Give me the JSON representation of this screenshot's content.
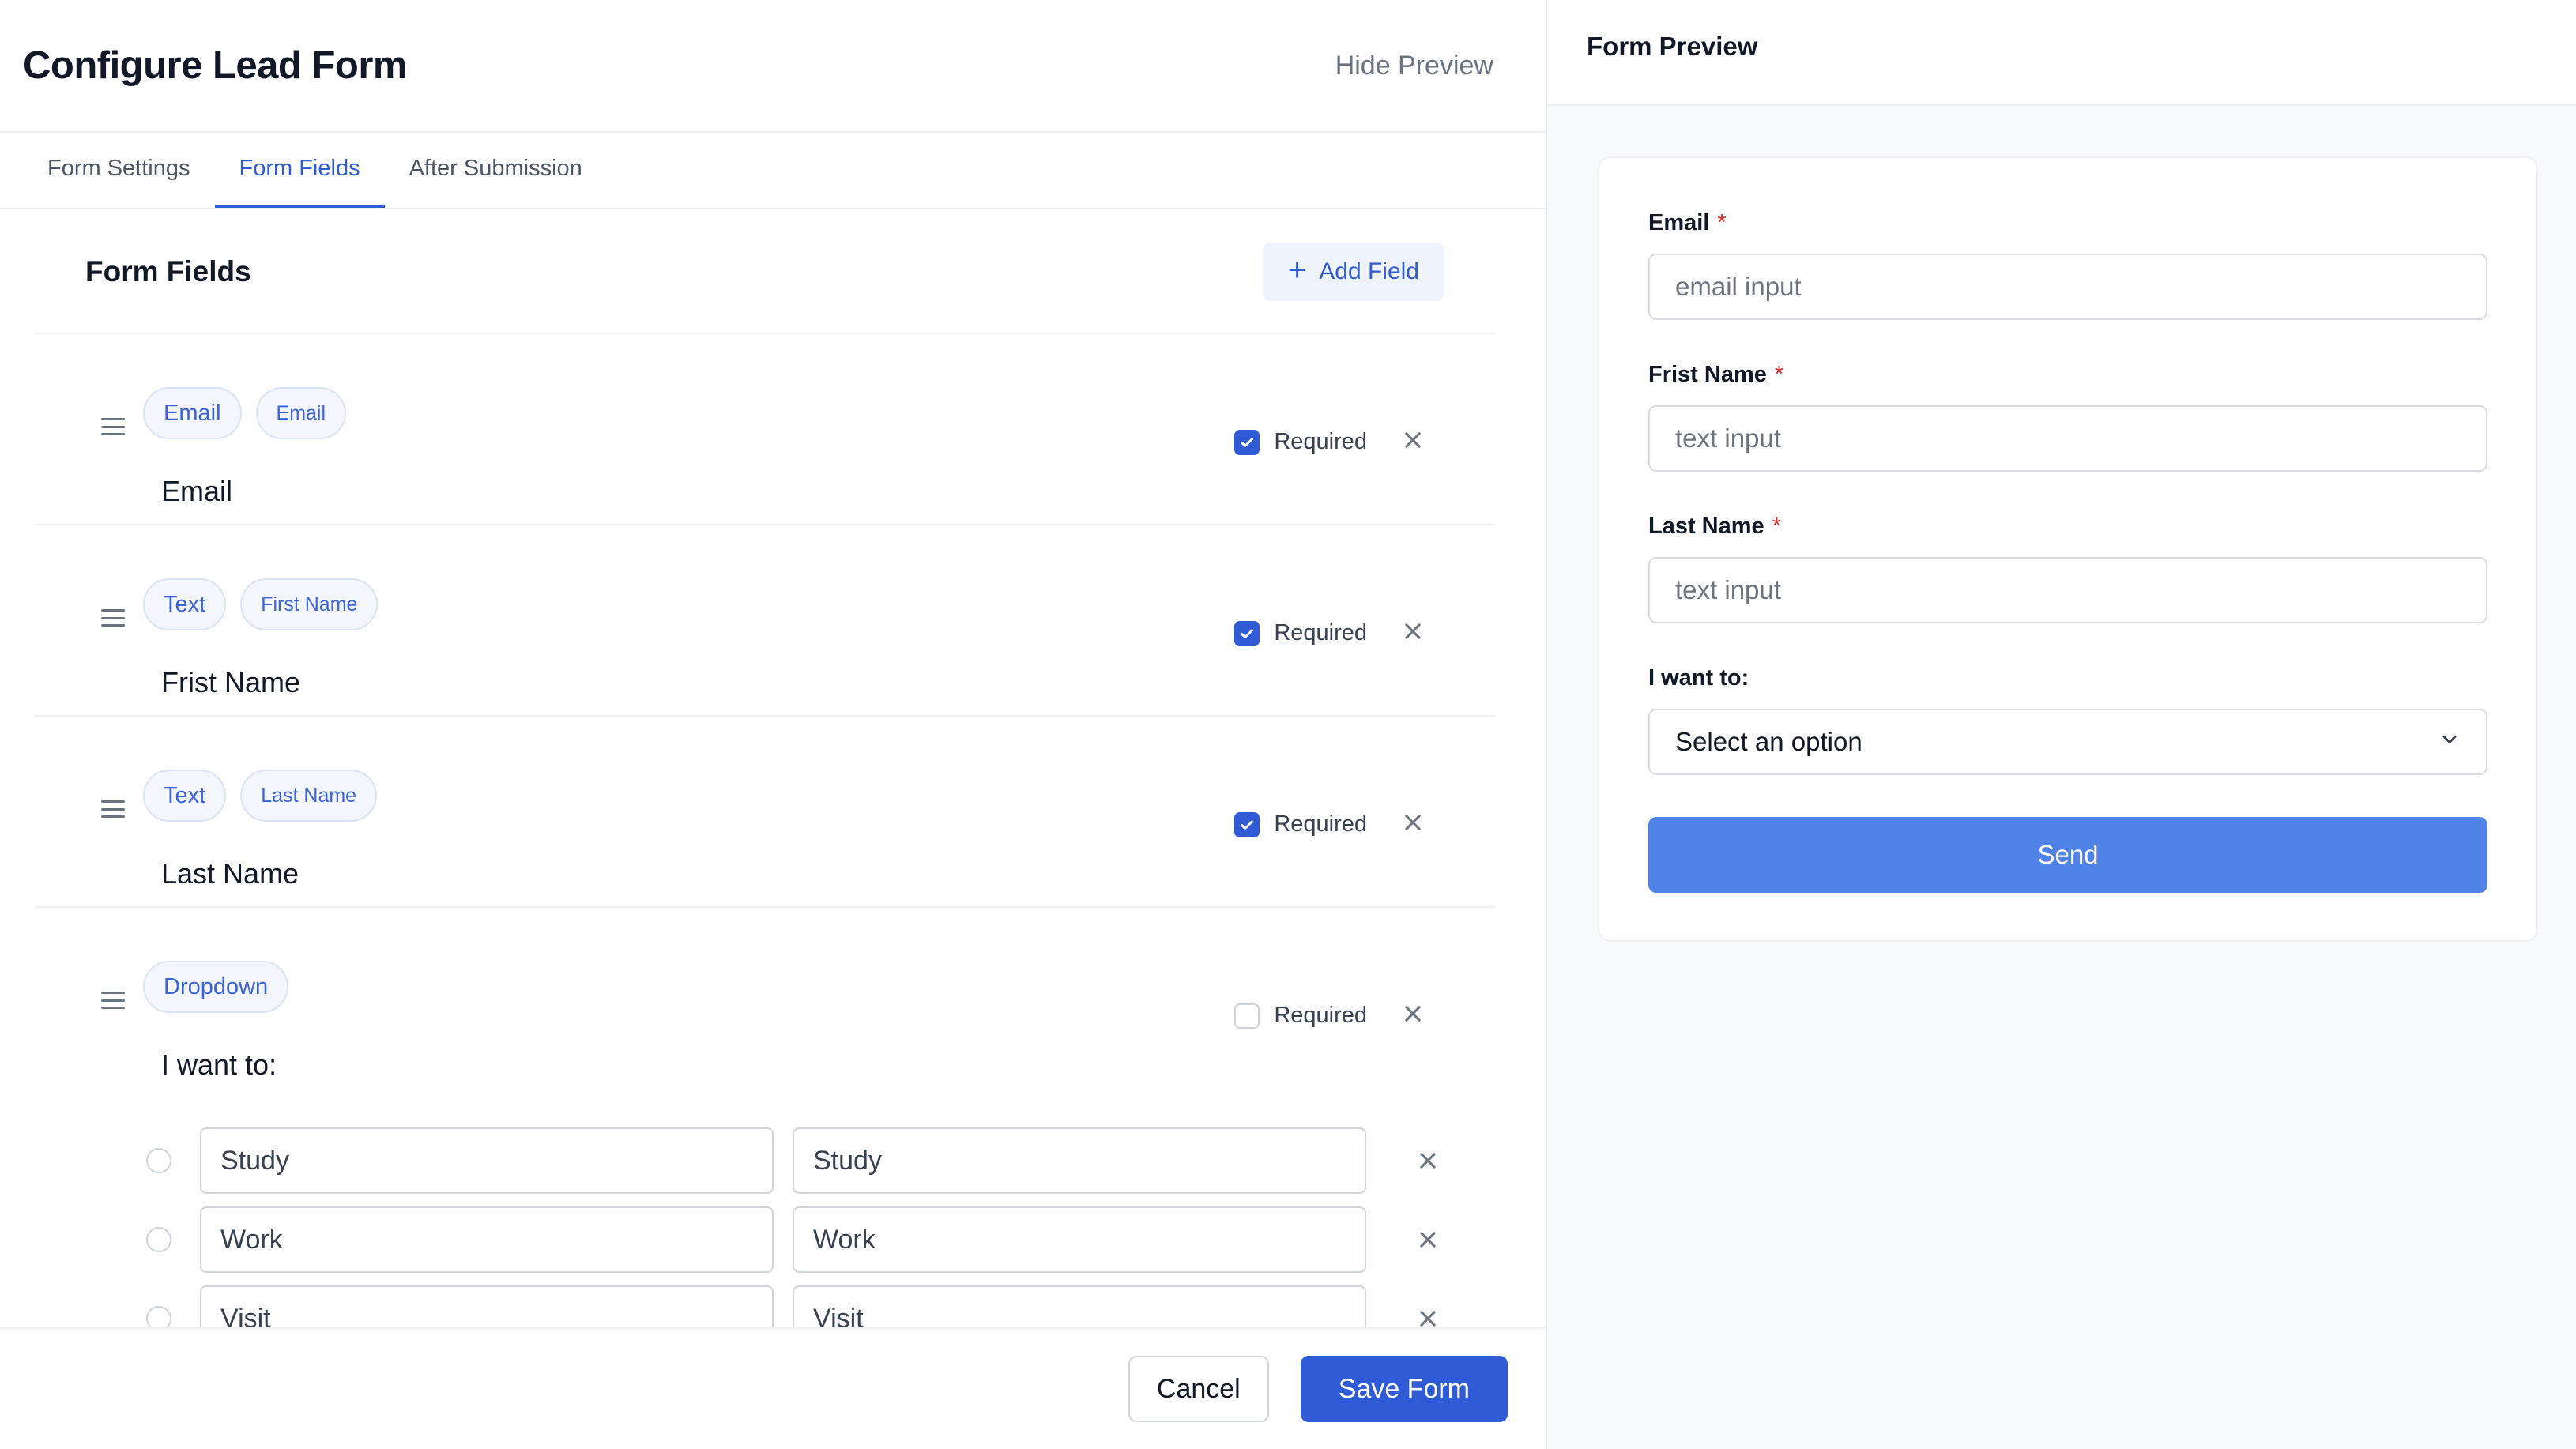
{
  "header": {
    "title": "Configure Lead Form",
    "hide_preview": "Hide Preview"
  },
  "tabs": [
    {
      "label": "Form Settings",
      "active": false
    },
    {
      "label": "Form Fields",
      "active": true
    },
    {
      "label": "After Submission",
      "active": false
    }
  ],
  "section": {
    "title": "Form Fields",
    "add_field": "Add Field"
  },
  "required_label": "Required",
  "fields": [
    {
      "type": "Email",
      "key": "Email",
      "label": "Email",
      "required": true
    },
    {
      "type": "Text",
      "key": "First Name",
      "label": "Frist Name",
      "required": true
    },
    {
      "type": "Text",
      "key": "Last Name",
      "label": "Last Name",
      "required": true
    },
    {
      "type": "Dropdown",
      "label": "I want to:",
      "required": false,
      "options": [
        {
          "label": "Study",
          "value": "Study"
        },
        {
          "label": "Work",
          "value": "Work"
        },
        {
          "label": "Visit",
          "value": "Visit"
        }
      ]
    }
  ],
  "footer": {
    "cancel": "Cancel",
    "save": "Save Form"
  },
  "preview": {
    "title": "Form Preview",
    "required_mark": "*",
    "fields": [
      {
        "label": "Email",
        "placeholder": "email input"
      },
      {
        "label": "Frist Name",
        "placeholder": "text input"
      },
      {
        "label": "Last Name",
        "placeholder": "text input"
      },
      {
        "label": "I want to:",
        "placeholder": "Select an option"
      }
    ],
    "send": "Send"
  },
  "colors": {
    "accent": "#2f5bd6",
    "send_button": "#4f83e8",
    "required_star": "#dc2626"
  }
}
